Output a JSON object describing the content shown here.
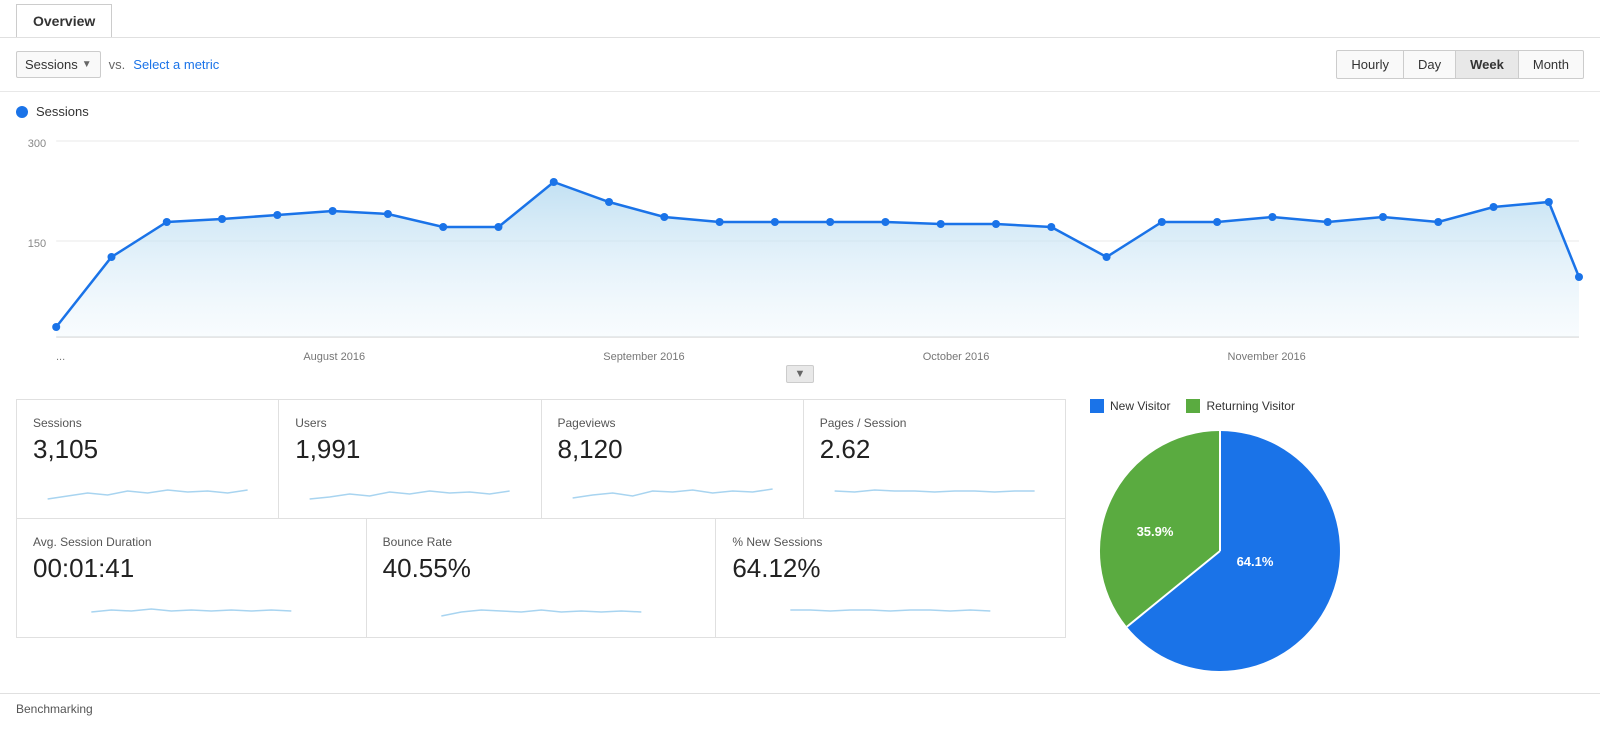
{
  "header": {
    "tab_label": "Overview"
  },
  "controls": {
    "metric_label": "Sessions",
    "vs_label": "vs.",
    "select_metric_label": "Select a metric",
    "time_buttons": [
      "Hourly",
      "Day",
      "Week",
      "Month"
    ],
    "active_time_button": "Week"
  },
  "chart": {
    "legend_label": "Sessions",
    "y_max": "300",
    "y_mid": "150",
    "x_labels": [
      "...",
      "August 2016",
      "September 2016",
      "October 2016",
      "November 2016"
    ],
    "accent_color": "#1a73e8",
    "fill_color": "#d0e8f8"
  },
  "metrics": [
    {
      "title": "Sessions",
      "value": "3,105"
    },
    {
      "title": "Users",
      "value": "1,991"
    },
    {
      "title": "Pageviews",
      "value": "8,120"
    },
    {
      "title": "Pages / Session",
      "value": "2.62"
    },
    {
      "title": "Avg. Session Duration",
      "value": "00:01:41"
    },
    {
      "title": "Bounce Rate",
      "value": "40.55%"
    },
    {
      "title": "% New Sessions",
      "value": "64.12%"
    }
  ],
  "pie": {
    "new_visitor_label": "New Visitor",
    "returning_visitor_label": "Returning Visitor",
    "new_visitor_color": "#1a73e8",
    "returning_visitor_color": "#5aab40",
    "new_visitor_pct": 64.1,
    "returning_visitor_pct": 35.9,
    "new_visitor_pct_label": "64.1%",
    "returning_visitor_pct_label": "35.9%"
  },
  "bottom": {
    "label": "Benchmarking"
  }
}
